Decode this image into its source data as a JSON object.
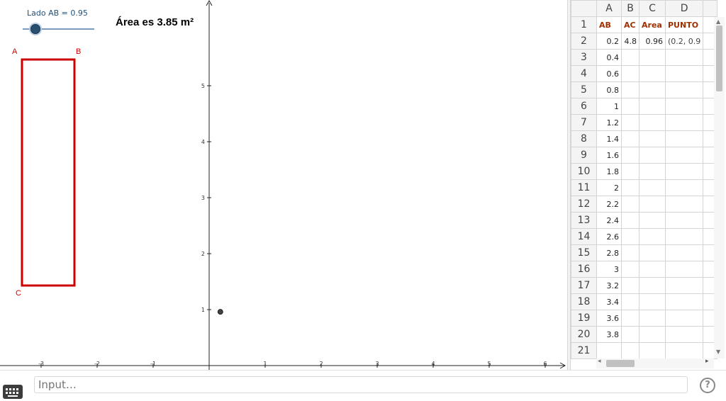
{
  "graphics": {
    "slider": {
      "label": "Lado AB = 0.95",
      "min": 0,
      "max": 4.8,
      "value": 0.95
    },
    "area_text": "Área  es  3.85 m²",
    "vertices": {
      "A": "A",
      "B": "B",
      "C": "C"
    },
    "x_ticks": [
      "-3",
      "-2",
      "-1",
      "1",
      "2",
      "3",
      "4",
      "5",
      "6"
    ],
    "y_ticks": [
      "1",
      "2",
      "3",
      "4",
      "5"
    ],
    "point": {
      "x": 0.2,
      "y": 0.96
    },
    "colors": {
      "rectangle": "#cc0000",
      "point": "#444444",
      "axes": "#222222"
    }
  },
  "spreadsheet": {
    "columns": [
      "A",
      "B",
      "C",
      "D"
    ],
    "rows": [
      {
        "n": "1",
        "cells": [
          "AB",
          "AC",
          "Area",
          "PUNTO"
        ]
      },
      {
        "n": "2",
        "cells": [
          "0.2",
          "4.8",
          "0.96",
          "(0.2, 0.9"
        ]
      },
      {
        "n": "3",
        "cells": [
          "0.4",
          "",
          "",
          ""
        ]
      },
      {
        "n": "4",
        "cells": [
          "0.6",
          "",
          "",
          ""
        ]
      },
      {
        "n": "5",
        "cells": [
          "0.8",
          "",
          "",
          ""
        ]
      },
      {
        "n": "6",
        "cells": [
          "1",
          "",
          "",
          ""
        ]
      },
      {
        "n": "7",
        "cells": [
          "1.2",
          "",
          "",
          ""
        ]
      },
      {
        "n": "8",
        "cells": [
          "1.4",
          "",
          "",
          ""
        ]
      },
      {
        "n": "9",
        "cells": [
          "1.6",
          "",
          "",
          ""
        ]
      },
      {
        "n": "10",
        "cells": [
          "1.8",
          "",
          "",
          ""
        ]
      },
      {
        "n": "11",
        "cells": [
          "2",
          "",
          "",
          ""
        ]
      },
      {
        "n": "12",
        "cells": [
          "2.2",
          "",
          "",
          ""
        ]
      },
      {
        "n": "13",
        "cells": [
          "2.4",
          "",
          "",
          ""
        ]
      },
      {
        "n": "14",
        "cells": [
          "2.6",
          "",
          "",
          ""
        ]
      },
      {
        "n": "15",
        "cells": [
          "2.8",
          "",
          "",
          ""
        ]
      },
      {
        "n": "16",
        "cells": [
          "3",
          "",
          "",
          ""
        ]
      },
      {
        "n": "17",
        "cells": [
          "3.2",
          "",
          "",
          ""
        ]
      },
      {
        "n": "18",
        "cells": [
          "3.4",
          "",
          "",
          ""
        ]
      },
      {
        "n": "19",
        "cells": [
          "3.6",
          "",
          "",
          ""
        ]
      },
      {
        "n": "20",
        "cells": [
          "3.8",
          "",
          "",
          ""
        ]
      },
      {
        "n": "21",
        "cells": [
          "",
          "",
          "",
          ""
        ]
      }
    ]
  },
  "input_bar": {
    "placeholder": "Input…",
    "help_icon": "help-icon",
    "keyboard_icon": "keyboard-icon"
  }
}
